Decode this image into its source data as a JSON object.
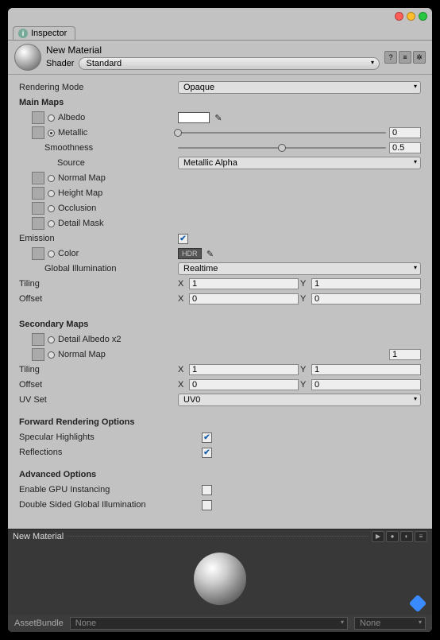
{
  "tab": {
    "label": "Inspector"
  },
  "header": {
    "name": "New Material",
    "shader_label": "Shader",
    "shader_value": "Standard"
  },
  "renderingMode": {
    "label": "Rendering Mode",
    "value": "Opaque"
  },
  "mainMaps": {
    "title": "Main Maps",
    "albedo": "Albedo",
    "metallic": "Metallic",
    "metallicValue": "0",
    "smoothness": "Smoothness",
    "smoothnessValue": "0.5",
    "source": "Source",
    "sourceValue": "Metallic Alpha",
    "normalMap": "Normal Map",
    "heightMap": "Height Map",
    "occlusion": "Occlusion",
    "detailMask": "Detail Mask"
  },
  "emission": {
    "label": "Emission",
    "color": "Color",
    "hdr": "HDR",
    "gi": "Global Illumination",
    "giValue": "Realtime"
  },
  "tiling": {
    "label": "Tiling",
    "x": "1",
    "y": "1"
  },
  "offset": {
    "label": "Offset",
    "x": "0",
    "y": "0"
  },
  "secondaryMaps": {
    "title": "Secondary Maps",
    "detailAlbedo": "Detail Albedo x2",
    "normalMap": "Normal Map",
    "normalMapValue": "1",
    "tiling": {
      "label": "Tiling",
      "x": "1",
      "y": "1"
    },
    "offset": {
      "label": "Offset",
      "x": "0",
      "y": "0"
    },
    "uvSet": "UV Set",
    "uvSetValue": "UV0"
  },
  "forward": {
    "title": "Forward Rendering Options",
    "specular": "Specular Highlights",
    "reflections": "Reflections"
  },
  "advanced": {
    "title": "Advanced Options",
    "gpu": "Enable GPU Instancing",
    "doubleSided": "Double Sided Global Illumination"
  },
  "preview": {
    "title": "New Material"
  },
  "assetBundle": {
    "label": "AssetBundle",
    "value": "None",
    "variant": "None"
  },
  "axis": {
    "x": "X",
    "y": "Y"
  }
}
